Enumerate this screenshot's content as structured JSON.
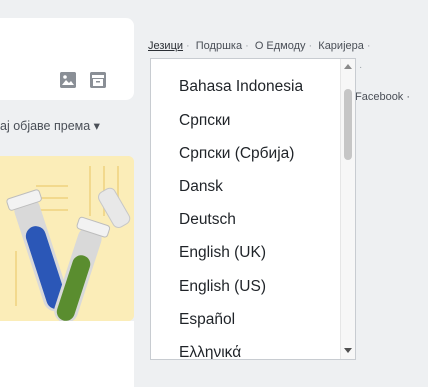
{
  "sort": {
    "label": "ај објаве према ▾"
  },
  "footer": {
    "links": [
      "Језици",
      "Подршка",
      "О Едмоду",
      "Каријера"
    ],
    "facebook": "Facebook ·"
  },
  "language_dropdown": {
    "options": [
      "Bahasa Indonesia",
      "Српски",
      "Српски (Србија)",
      "Dansk",
      "Deutsch",
      "English (UK)",
      "English (US)",
      "Español",
      "Ελληνικά"
    ]
  }
}
